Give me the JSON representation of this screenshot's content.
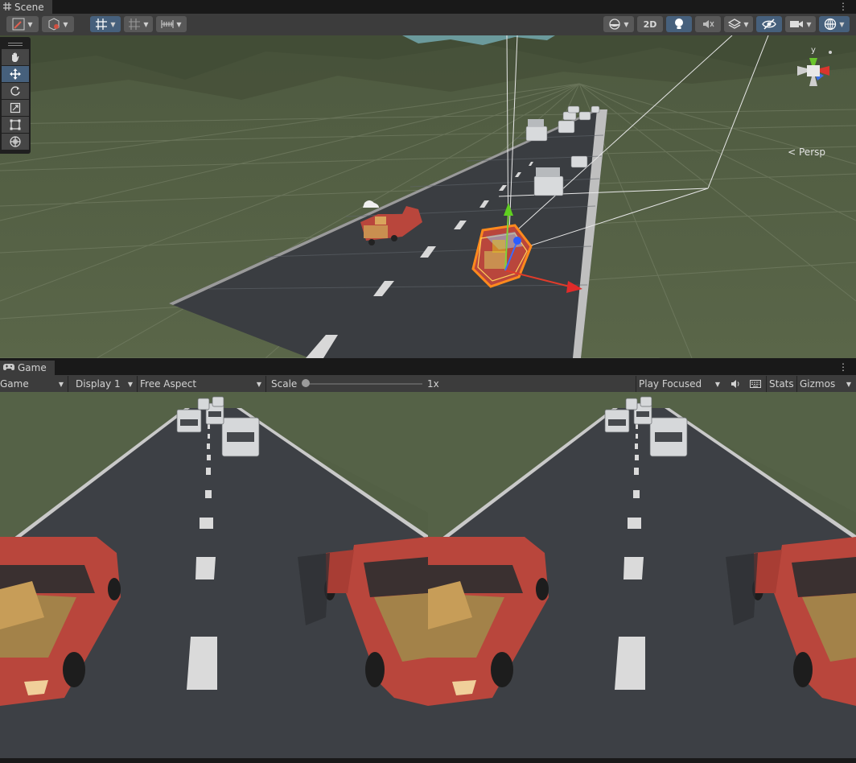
{
  "scene": {
    "tab_label": "Scene",
    "toolbar": {
      "two_d_label": "2D"
    },
    "persp_label": "Persp",
    "gizmo_axis_y": "y"
  },
  "game": {
    "tab_label": "Game",
    "toolbar": {
      "view_select": "Game",
      "display_select": "Display 1",
      "aspect_select": "Free Aspect",
      "scale_label": "Scale",
      "scale_value_label": "1x",
      "scale_fraction": 0.0,
      "play_mode_select": "Play Focused",
      "stats_label": "Stats",
      "gizmos_label": "Gizmos"
    }
  },
  "colors": {
    "panel_bg": "#3c3c3c",
    "tab_bg": "#191919",
    "active_button": "#46607c",
    "button": "#585858",
    "terrain": "#536045",
    "road": "#3a3d41",
    "car_red": "#b9463c",
    "selection_outline": "#ff8a1d"
  }
}
